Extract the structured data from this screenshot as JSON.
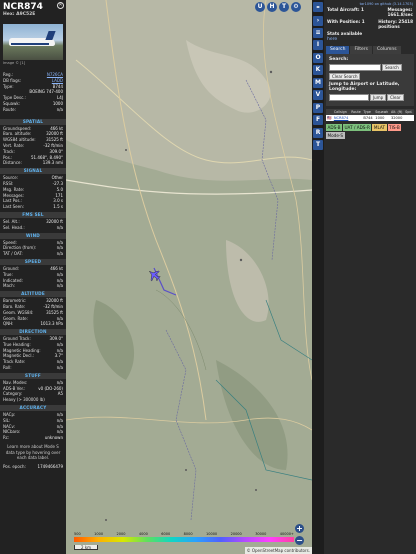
{
  "aircraft": {
    "callsign": "NCR874",
    "hex_line": "Hex: A9C52E",
    "photo_note": "Image © [1]"
  },
  "details": [
    {
      "k": "Reg.:",
      "v": "N726CA",
      "link": true
    },
    {
      "k": "DB flags:",
      "v": "LADD",
      "link": true
    },
    {
      "k": "Type:",
      "v": "B744",
      "link": false
    },
    {
      "k": "",
      "v": "BOEING 747-400",
      "link": false
    },
    {
      "k": "Type Desc.:",
      "v": "L4J",
      "link": false
    },
    {
      "k": "Squawk:",
      "v": "1000",
      "link": false
    },
    {
      "k": "Route:",
      "v": "n/a",
      "link": false
    }
  ],
  "sections": [
    {
      "title": "SPATIAL",
      "rows": [
        {
          "k": "Groundspeed:",
          "v": "466 kt"
        },
        {
          "k": "Baro. altitude:",
          "v": "32000 ft"
        },
        {
          "k": "WGS84 altitude:",
          "v": "31525 ft"
        },
        {
          "k": "Vert. Rate:",
          "v": "-32 ft/min"
        },
        {
          "k": "Track:",
          "v": "309.0°"
        },
        {
          "k": "Pos.:",
          "v": "51.468°, 8.490°"
        },
        {
          "k": "Distance:",
          "v": "139.3 nmi"
        }
      ]
    },
    {
      "title": "SIGNAL",
      "rows": [
        {
          "k": "Source:",
          "v": "Other"
        },
        {
          "k": "RSSI:",
          "v": "-27.3"
        },
        {
          "k": "Msg. Rate:",
          "v": "5.0"
        },
        {
          "k": "Messages:",
          "v": "171"
        },
        {
          "k": "Last Pos.:",
          "v": "3.0 s"
        },
        {
          "k": "Last Seen:",
          "v": "1.5 s"
        }
      ]
    },
    {
      "title": "FMS SEL",
      "rows": [
        {
          "k": "Sel. Alt.:",
          "v": "32000 ft"
        },
        {
          "k": "Sel. Head.:",
          "v": "n/a"
        }
      ]
    },
    {
      "title": "WIND",
      "rows": [
        {
          "k": "Speed:",
          "v": "n/a"
        },
        {
          "k": "Direction (from):",
          "v": "n/a"
        },
        {
          "k": "TAT / OAT:",
          "v": "n/a"
        }
      ]
    },
    {
      "title": "SPEED",
      "rows": [
        {
          "k": "Ground:",
          "v": "466 kt"
        },
        {
          "k": "True:",
          "v": "n/a"
        },
        {
          "k": "Indicated:",
          "v": "n/a"
        },
        {
          "k": "Mach:",
          "v": "n/a"
        }
      ]
    },
    {
      "title": "ALTITUDE",
      "rows": [
        {
          "k": "Barometric:",
          "v": "32000 ft"
        },
        {
          "k": "Baro. Rate:",
          "v": "-32 ft/min"
        },
        {
          "k": "Geom. WGS84:",
          "v": "31525 ft"
        },
        {
          "k": "Geom. Rate:",
          "v": "n/a"
        },
        {
          "k": "QNH:",
          "v": "1013.3 hPa"
        }
      ]
    },
    {
      "title": "DIRECTION",
      "rows": [
        {
          "k": "Ground Track:",
          "v": "309.0°"
        },
        {
          "k": "True Heading:",
          "v": "n/a"
        },
        {
          "k": "Magnetic Heading:",
          "v": "n/a"
        },
        {
          "k": "Magnetic Decl.:",
          "v": "3.7°"
        },
        {
          "k": "Track Rate:",
          "v": "n/a"
        },
        {
          "k": "Roll:",
          "v": "n/a"
        }
      ]
    },
    {
      "title": "STUFF",
      "rows": [
        {
          "k": "Nav. Modes:",
          "v": "n/a"
        },
        {
          "k": "ADS-B Ver.:",
          "v": "v0 (DO-260)"
        },
        {
          "k": "Category:",
          "v": "A5"
        },
        {
          "k": "Heavy (> 300000 lb)",
          "v": ""
        }
      ]
    },
    {
      "title": "ACCURACY",
      "rows": [
        {
          "k": "NACp:",
          "v": "n/a"
        },
        {
          "k": "SIL:",
          "v": "n/a"
        },
        {
          "k": "NACv:",
          "v": "n/a"
        },
        {
          "k": "NICbaro:",
          "v": "n/a"
        },
        {
          "k": "Rc:",
          "v": "unknown"
        }
      ]
    }
  ],
  "footer_note": "Learn more about Mode S data type by hovering over each data label.",
  "pos_epoch": {
    "k": "Pos. epoch:",
    "v": "1749466479"
  },
  "map": {
    "zoom_in": "+",
    "zoom_out": "−",
    "attribution": "© OpenStreetMap contributors.",
    "scale": "2 km",
    "alt_labels": [
      "500",
      "1000",
      "2000",
      "4000",
      "6000",
      "8000",
      "10000",
      "20000",
      "30000",
      "40000+"
    ]
  },
  "top_buttons": [
    "U",
    "H",
    "T"
  ],
  "side_buttons": [
    "I",
    "O",
    "K",
    "M",
    "V",
    "P",
    "F",
    "R",
    "T"
  ],
  "sidebar": {
    "github": "tar1090 on github (3.14.1703)",
    "total_label": "Total Aircraft: 1",
    "messages_label": "Messages:",
    "messages_value": "1661.8/sec",
    "withpos_label": "With Position: 1",
    "history_label": "History: 25418",
    "history_sub": "positions",
    "stats_label": "Stats available",
    "stats_link": "here",
    "tabs": [
      "Search",
      "Filters",
      "Columns"
    ],
    "search_label": "Search:",
    "search_btn": "Search",
    "clear_search_btn": "Clear Search",
    "jump_label": "Jump to Airport or Latitude, Longitude:",
    "jump_btn": "Jump",
    "clear_btn": "Clear",
    "table_headers": [
      "",
      "Callsign",
      "Route",
      "Type",
      "Squawk",
      "Alt. (ft)",
      "Spd."
    ],
    "table_rows": [
      [
        "🇺🇸",
        "NCR874",
        "",
        "B744",
        "1000",
        "32000",
        ""
      ]
    ],
    "badges": [
      "ADS-B",
      "UAT / ADS-R",
      "MLAT",
      "TIS-B",
      "Mode-S"
    ]
  }
}
